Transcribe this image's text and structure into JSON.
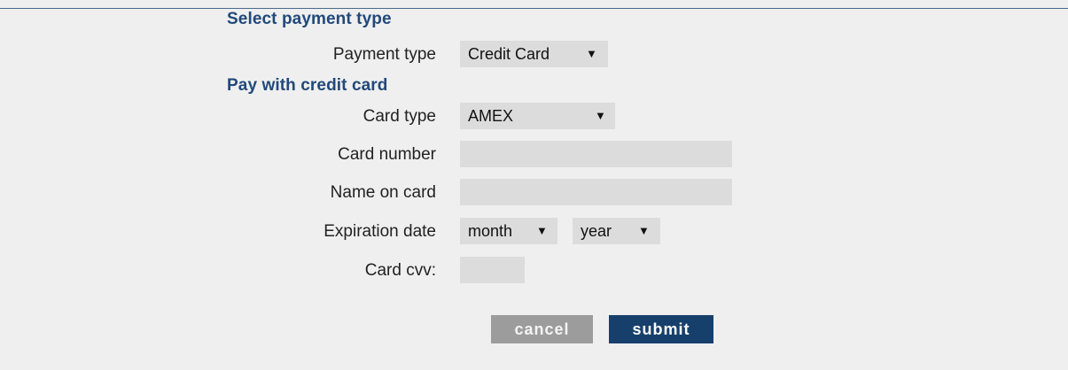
{
  "sections": {
    "payment_type_heading": "Select payment type",
    "credit_card_heading": "Pay with credit card"
  },
  "fields": {
    "payment_type": {
      "label": "Payment type",
      "value": "Credit Card"
    },
    "card_type": {
      "label": "Card type",
      "value": "AMEX"
    },
    "card_number": {
      "label": "Card number",
      "value": ""
    },
    "name_on_card": {
      "label": "Name on card",
      "value": ""
    },
    "expiration_date": {
      "label": "Expiration date",
      "month": "month",
      "year": "year"
    },
    "card_cvv": {
      "label": "Card cvv:",
      "value": ""
    }
  },
  "icons": {
    "dropdown_arrow": "▼"
  },
  "buttons": {
    "cancel": "cancel",
    "submit": "submit"
  },
  "colors": {
    "heading": "#21497a",
    "submit_bg": "#173f6b",
    "cancel_bg": "#9c9c9c",
    "field_bg": "#dcdcdc",
    "page_bg": "#efefef"
  }
}
